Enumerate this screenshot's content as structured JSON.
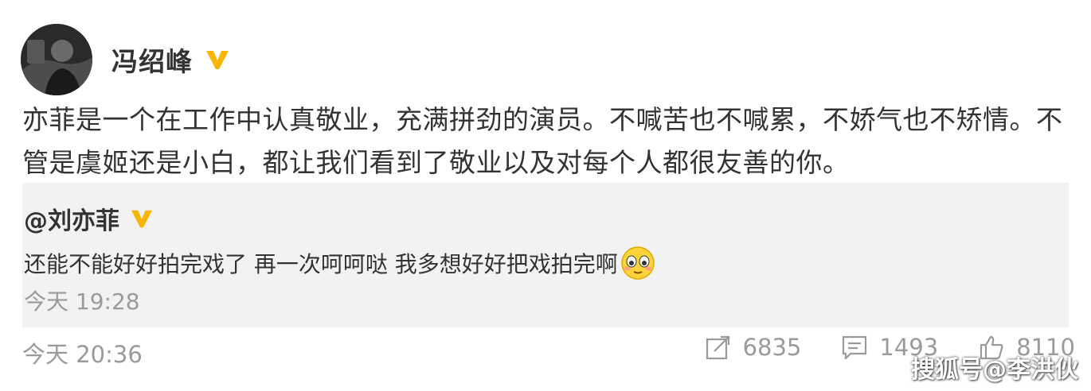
{
  "author": {
    "name": "冯绍峰",
    "avatar_icon": "avatar",
    "verified_icon": "verified-v-icon",
    "verified_color": "#f7b500"
  },
  "post": {
    "text": "亦菲是一个在工作中认真敬业，充满拼劲的演员。不喊苦也不喊累，不娇气也不矫情。不管是虞姬还是小白，都让我们看到了敬业以及对每个人都很友善的你。",
    "time": "今天 20:36"
  },
  "repost": {
    "author": "@刘亦菲",
    "text": "还能不能好好拍完戏了 再一次呵呵哒 我多想好好把戏拍完啊",
    "emoji_icon": "shy-face-emoji",
    "time": "今天 19:28"
  },
  "actions": [
    {
      "icon": "repost-icon",
      "count": "6835"
    },
    {
      "icon": "comment-icon",
      "count": "1493"
    },
    {
      "icon": "like-icon",
      "count": "8110"
    }
  ],
  "watermark": "搜狐号@李洪伙"
}
